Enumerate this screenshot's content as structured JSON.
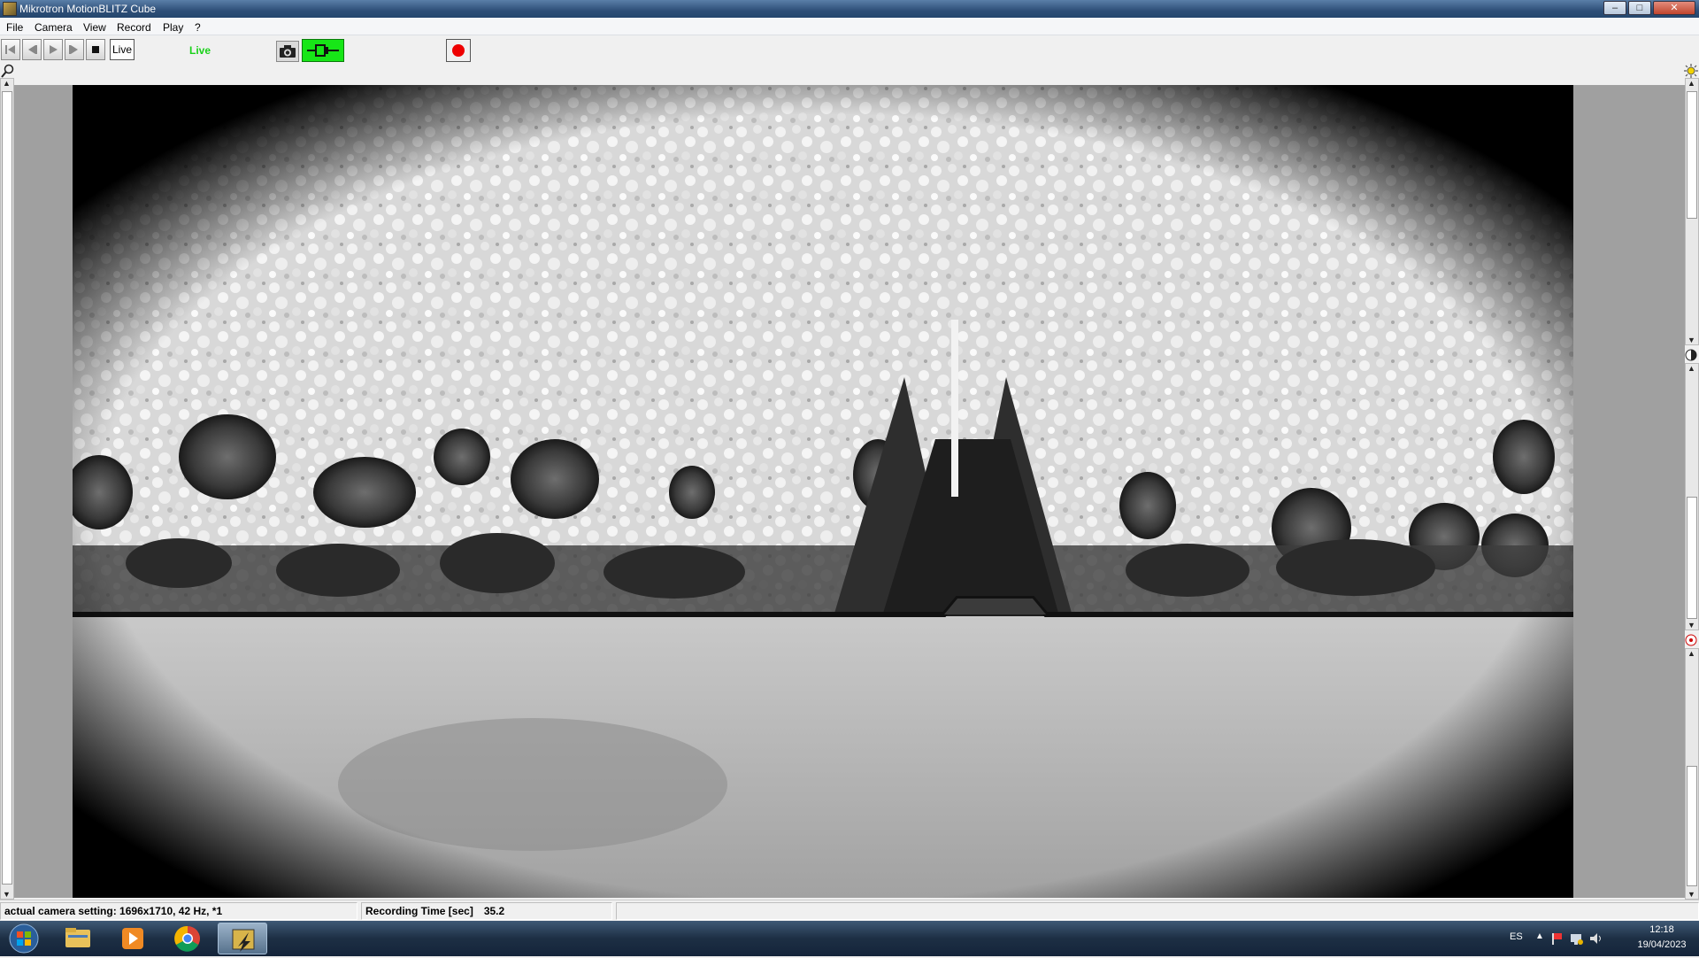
{
  "window": {
    "title": "Mikrotron MotionBLITZ Cube",
    "minimize": "–",
    "maximize": "□",
    "close": "✕"
  },
  "menu": [
    "File",
    "Camera",
    "View",
    "Record",
    "Play",
    "?"
  ],
  "toolbar": {
    "live_button": "Live",
    "status": "Live"
  },
  "status_bar": {
    "camera_setting": "actual camera setting:  1696x1710, 42 Hz, *1",
    "recording_label": "Recording Time [sec]",
    "recording_value": "35.2"
  },
  "taskbar": {
    "language": "ES",
    "time": "12:18",
    "date": "19/04/2023"
  },
  "colors": {
    "live_green": "#19d119",
    "trigger_green": "#17e617",
    "record_red": "#e00000"
  }
}
